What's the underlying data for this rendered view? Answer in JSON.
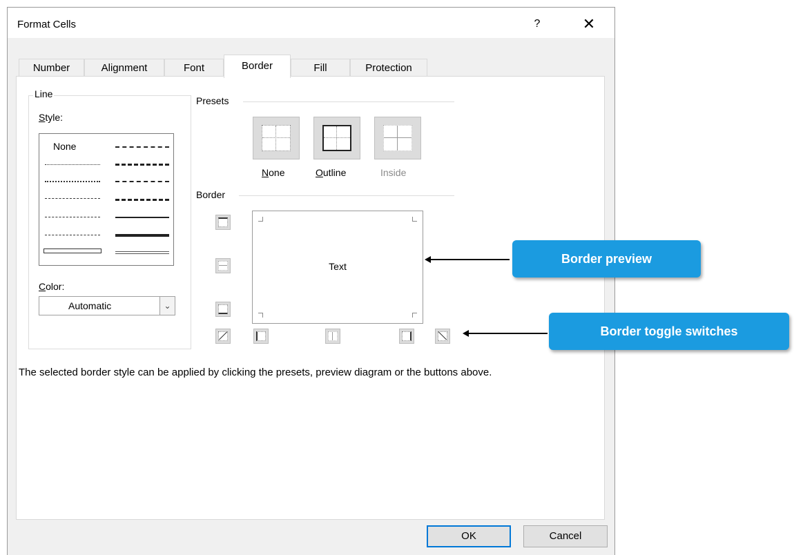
{
  "dialog": {
    "title": "Format Cells",
    "help_label": "?",
    "close_label": "✕"
  },
  "tabs": [
    {
      "label": "Number",
      "active": false
    },
    {
      "label": "Alignment",
      "active": false
    },
    {
      "label": "Font",
      "active": false
    },
    {
      "label": "Border",
      "active": true
    },
    {
      "label": "Fill",
      "active": false
    },
    {
      "label": "Protection",
      "active": false
    }
  ],
  "line_group": {
    "title": "Line",
    "style_label_prefix": "S",
    "style_label_rest": "tyle:",
    "style_none": "None",
    "color_label_prefix": "C",
    "color_label_rest": "olor:",
    "color_value": "Automatic",
    "dropdown_icon": "chevron-down"
  },
  "presets": {
    "title": "Presets",
    "none_prefix": "N",
    "none_rest": "one",
    "outline_prefix": "O",
    "outline_rest": "utline",
    "inside_label": "Inside"
  },
  "border": {
    "title": "Border",
    "preview_text": "Text"
  },
  "description": "The selected border style can be applied by clicking the presets, preview diagram or the buttons above.",
  "buttons": {
    "ok": "OK",
    "cancel": "Cancel"
  },
  "callouts": {
    "preview": "Border preview",
    "toggles": "Border toggle switches"
  },
  "colors": {
    "callout": "#1b9be0",
    "ok_border": "#0078d7",
    "dialog_bg": "#f0f0f0"
  }
}
